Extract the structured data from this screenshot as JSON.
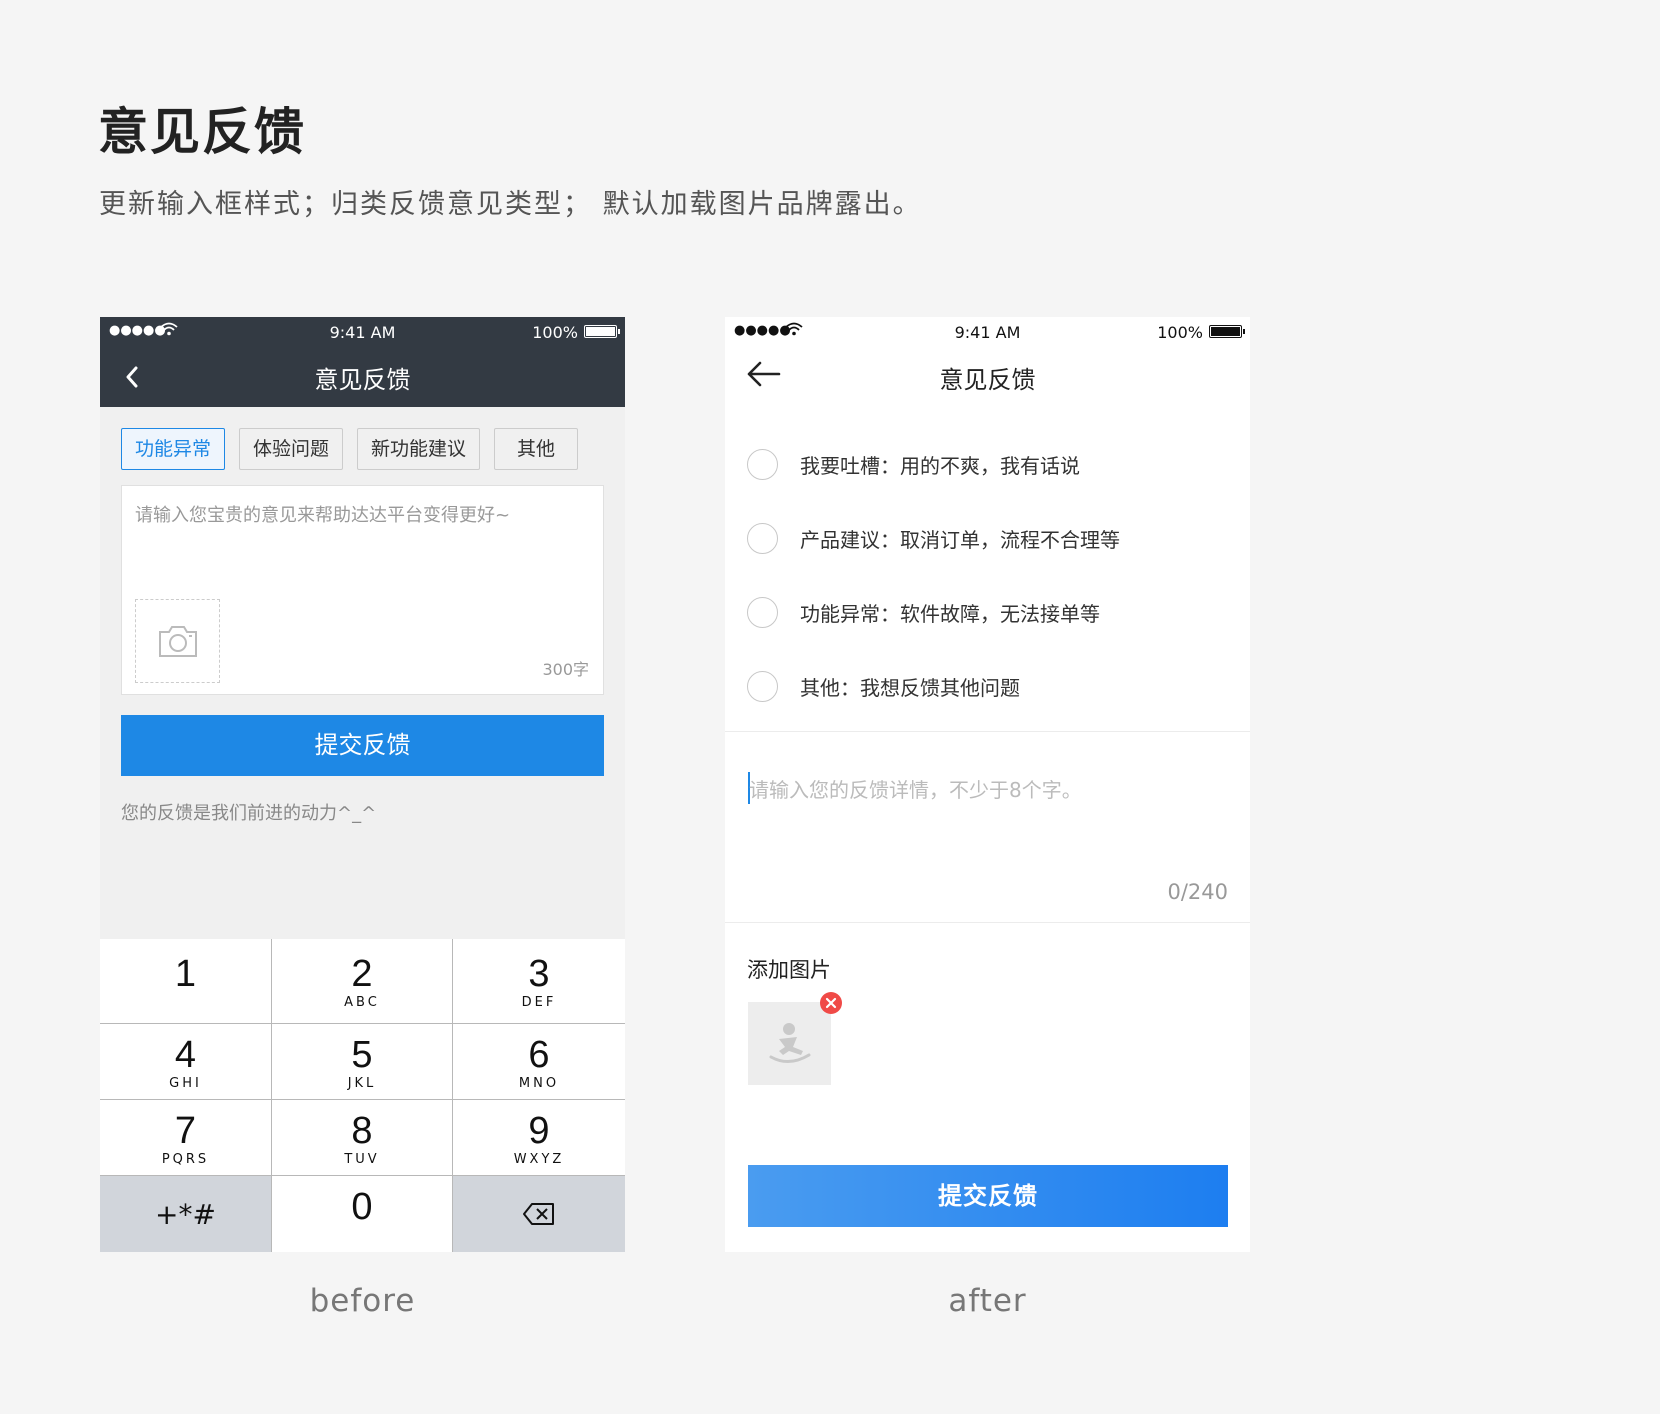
{
  "page": {
    "title": "意见反馈",
    "subtitle": "更新输入框样式；归类反馈意见类型； 默认加载图片品牌露出。"
  },
  "before": {
    "caption": "before",
    "status": {
      "signal": "●●●●●",
      "time": "9:41 AM",
      "battery": "100%"
    },
    "nav_title": "意见反馈",
    "tags": [
      {
        "label": "功能异常",
        "selected": true
      },
      {
        "label": "体验问题",
        "selected": false
      },
      {
        "label": "新功能建议",
        "selected": false
      },
      {
        "label": "其他",
        "selected": false
      }
    ],
    "input_placeholder": "请输入您宝贵的意见来帮助达达平台变得更好~",
    "char_limit": "300字",
    "submit_label": "提交反馈",
    "hint": "您的反馈是我们前进的动力^_^",
    "keypad": [
      {
        "num": "1",
        "letters": ""
      },
      {
        "num": "2",
        "letters": "ABC"
      },
      {
        "num": "3",
        "letters": "DEF"
      },
      {
        "num": "4",
        "letters": "GHI"
      },
      {
        "num": "5",
        "letters": "JKL"
      },
      {
        "num": "6",
        "letters": "MNO"
      },
      {
        "num": "7",
        "letters": "PQRS"
      },
      {
        "num": "8",
        "letters": "TUV"
      },
      {
        "num": "9",
        "letters": "WXYZ"
      },
      {
        "num": "+*#",
        "letters": ""
      },
      {
        "num": "0",
        "letters": ""
      },
      {
        "num": "⌫",
        "letters": ""
      }
    ],
    "colors": {
      "header_bg": "#333a43",
      "accent": "#1e88e5"
    }
  },
  "after": {
    "caption": "after",
    "status": {
      "signal": "●●●●●",
      "time": "9:41 AM",
      "battery": "100%"
    },
    "nav_title": "意见反馈",
    "options": [
      {
        "label": "我要吐槽：用的不爽，我有话说"
      },
      {
        "label": "产品建议：取消订单，流程不合理等"
      },
      {
        "label": "功能异常：软件故障，无法接单等"
      },
      {
        "label": "其他：我想反馈其他问题"
      }
    ],
    "textarea_placeholder": "请输入您的反馈详情，不少于8个字。",
    "counter": "0/240",
    "add_image_title": "添加图片",
    "submit_label": "提交反馈",
    "icons": {
      "back": "arrow-left-icon",
      "remove": "close-icon",
      "placeholder_image": "brand-logo-icon"
    }
  }
}
